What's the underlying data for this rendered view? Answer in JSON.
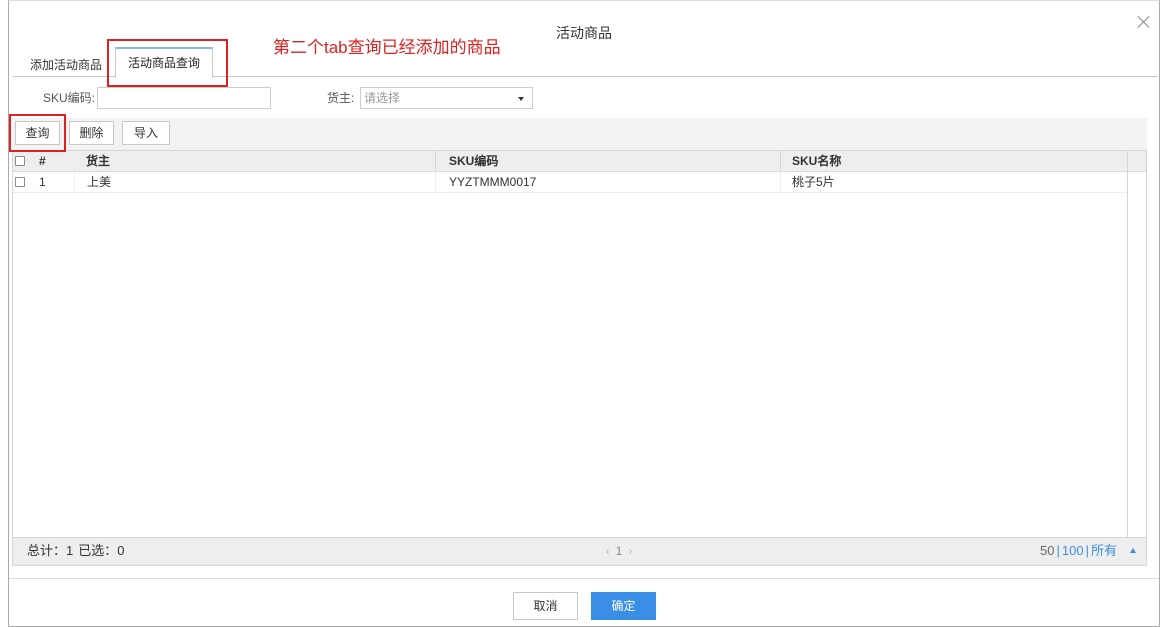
{
  "dialog": {
    "title": "活动商品"
  },
  "icons": {
    "close": "close-icon",
    "select_caret": "caret-down-icon",
    "checkbox": "checkbox-icon",
    "prev_page": "chevron-left-icon",
    "next_page": "chevron-right-icon",
    "page_size_toggle": "caret-up-icon"
  },
  "tabs": [
    {
      "label": "添加活动商品",
      "active": false
    },
    {
      "label": "活动商品查询",
      "active": true
    }
  ],
  "annotation": {
    "text": "第二个tab查询已经添加的商品"
  },
  "filters": {
    "sku_code": {
      "label": "SKU编码:",
      "value": ""
    },
    "owner": {
      "label": "货主:",
      "placeholder": "请选择",
      "value": ""
    }
  },
  "toolbar": {
    "query_label": "查询",
    "delete_label": "删除",
    "import_label": "导入"
  },
  "table": {
    "columns": [
      "#",
      "货主",
      "SKU编码",
      "SKU名称"
    ],
    "rows": [
      {
        "index": "1",
        "owner": "上美",
        "sku_code": "YYZTMMM0017",
        "sku_name": "桃子5片",
        "checked": false
      }
    ]
  },
  "footer": {
    "total_label": "总计：",
    "total": "1",
    "selected_label": "已选：",
    "selected": "0",
    "current_page": "1",
    "page_sizes": [
      "50",
      "100",
      "所有"
    ],
    "page_size_separator": "|"
  },
  "actions": {
    "cancel_label": "取消",
    "confirm_label": "确定"
  },
  "colors": {
    "primary": "#3a8ee6",
    "annotation": "#e02020",
    "link": "#3d8fe0"
  }
}
